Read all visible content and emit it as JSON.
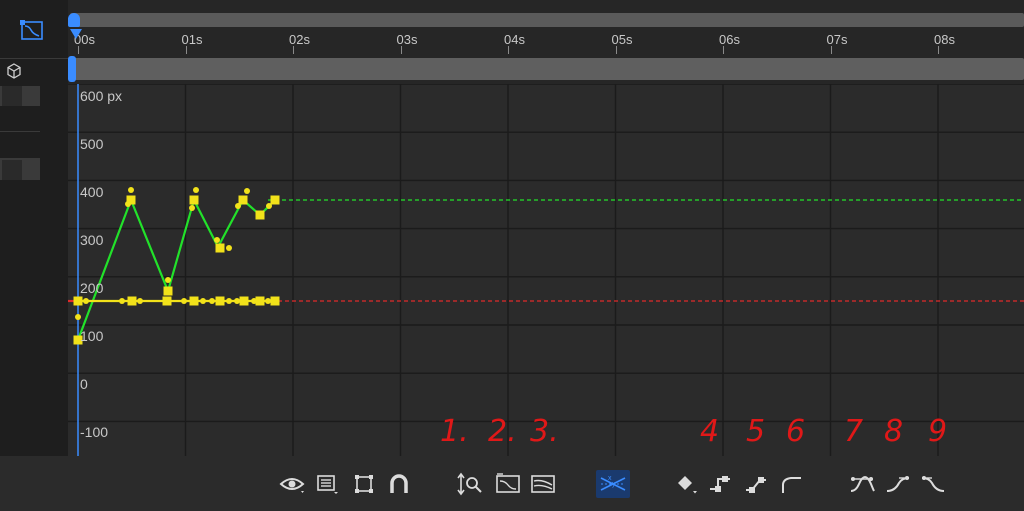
{
  "time_ruler": {
    "labels": [
      "00s",
      "01s",
      "02s",
      "03s",
      "04s",
      "05s",
      "06s",
      "07s",
      "08s"
    ]
  },
  "graph": {
    "y_labels": [
      "600 px",
      "500",
      "400",
      "300",
      "200",
      "100",
      "0",
      "-100"
    ]
  },
  "annotations": [
    "1.",
    "2.",
    "3.",
    "4",
    "5",
    "6",
    "7",
    "8",
    "9"
  ],
  "toolbar": {
    "icons": [
      "eye-icon",
      "list-icon",
      "transform-box-icon",
      "snap-magnet-icon",
      "zoom-vertical-icon",
      "fit-selection-icon",
      "fit-all-icon",
      "separate-dimensions-icon",
      "keyframe-diamond-icon",
      "convert-hold-icon",
      "convert-linear-icon",
      "convert-auto-bezier-icon",
      "easy-ease-icon",
      "easy-ease-in-icon",
      "easy-ease-out-icon"
    ]
  },
  "colors": {
    "green_curve": "#22e22a",
    "red_curve": "#e02a2a",
    "keyframe": "#f2e21a",
    "playhead": "#3a8cff",
    "active_tool": "#1a6bd6"
  }
}
